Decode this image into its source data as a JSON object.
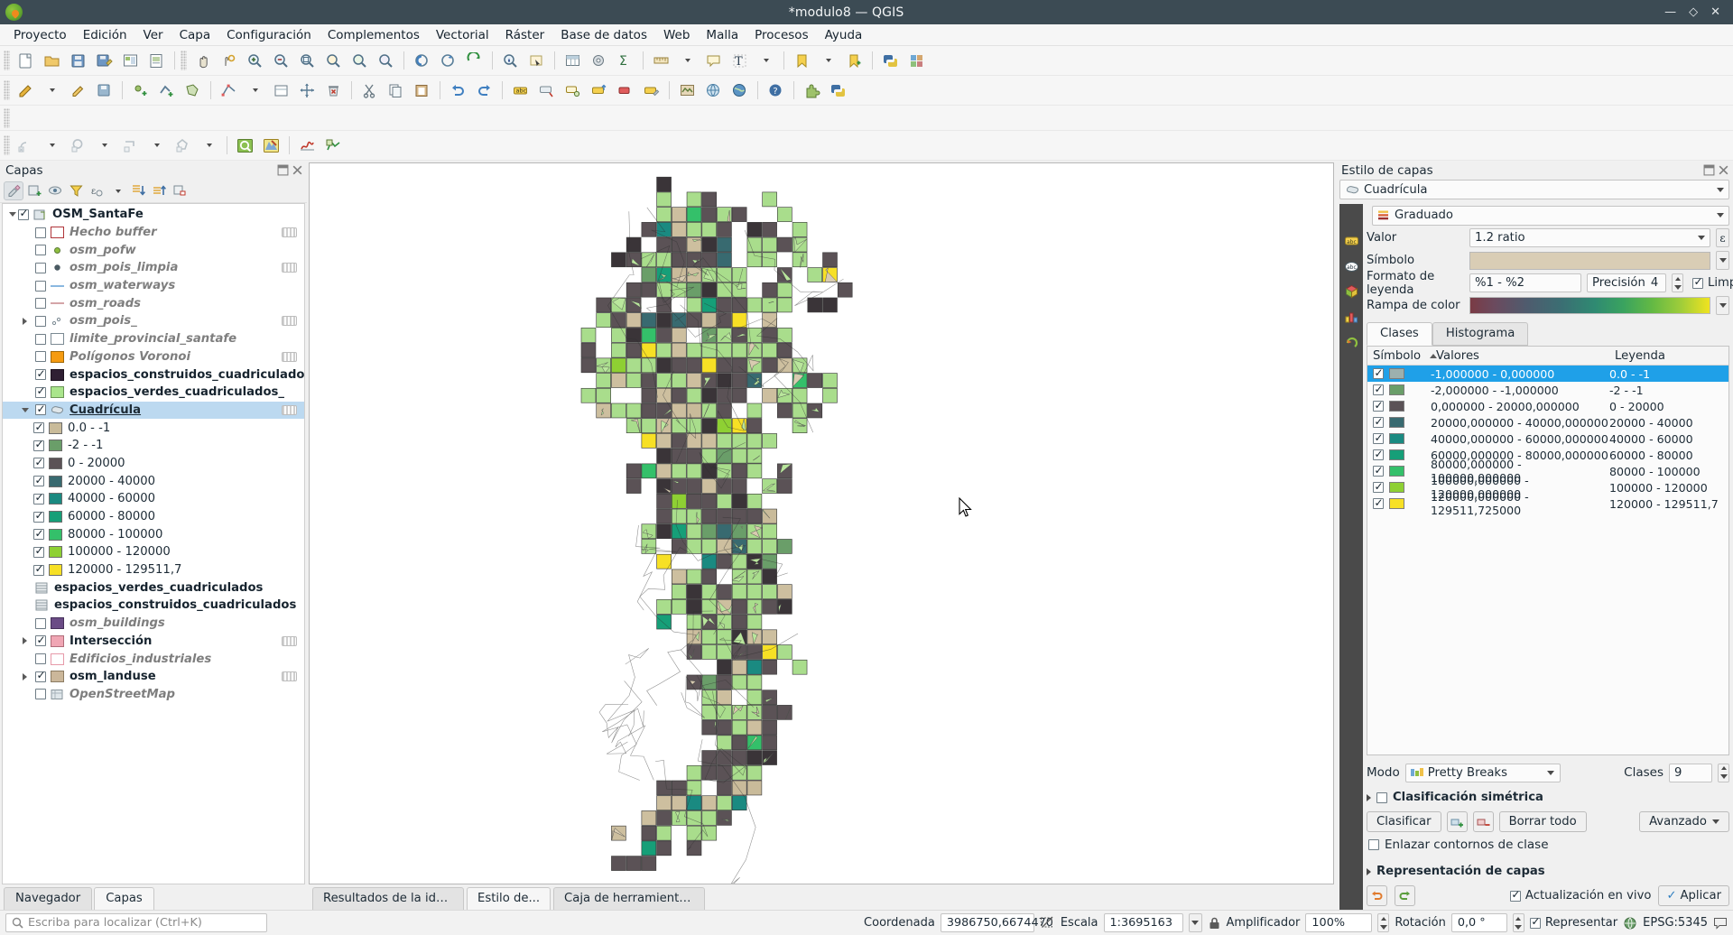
{
  "window": {
    "title": "*modulo8 — QGIS",
    "minimize": "—",
    "maximize": "◇",
    "close": "✕"
  },
  "menubar": {
    "items": [
      "Proyecto",
      "Edición",
      "Ver",
      "Capa",
      "Configuración",
      "Complementos",
      "Vectorial",
      "Ráster",
      "Base de datos",
      "Web",
      "Malla",
      "Procesos",
      "Ayuda"
    ]
  },
  "panels": {
    "layers": {
      "title": "Capas",
      "toolbar_icons": [
        "open-layer-styling-panel-icon",
        "add-group-icon",
        "manage-map-themes-icon",
        "filter-legend-icon",
        "filter-legend-expression-icon",
        "expand-all-icon",
        "collapse-all-icon",
        "remove-layer-icon"
      ],
      "tree": [
        {
          "indent": 0,
          "expander": "down",
          "checked": true,
          "icon": "group-icon",
          "label": "OSM_SantaFe",
          "style": "bold",
          "edit_indicator": false
        },
        {
          "indent": 1,
          "expander": "none",
          "checked": false,
          "icon": "polygon-outline-red-icon",
          "label": "Hecho buffer",
          "style": "italic",
          "edit_indicator": true,
          "swatch": "#ffffff",
          "swatch_border": "#b0353a"
        },
        {
          "indent": 1,
          "expander": "none",
          "checked": false,
          "icon": "point-green-icon",
          "label": "osm_pofw",
          "style": "italic",
          "edit_indicator": false,
          "swatch": "#7fb539"
        },
        {
          "indent": 1,
          "expander": "none",
          "checked": false,
          "icon": "point-dark-icon",
          "label": "osm_pois_limpia",
          "style": "italic",
          "edit_indicator": true,
          "swatch": "#4a5a62"
        },
        {
          "indent": 1,
          "expander": "none",
          "checked": false,
          "icon": "line-blue-icon",
          "label": "osm_waterways",
          "style": "italic",
          "edit_indicator": false,
          "swatch": "#83b4e0"
        },
        {
          "indent": 1,
          "expander": "none",
          "checked": false,
          "icon": "line-pink-icon",
          "label": "osm_roads",
          "style": "italic",
          "edit_indicator": false,
          "swatch": "#d6a7aa"
        },
        {
          "indent": 1,
          "expander": "right",
          "checked": false,
          "icon": "points-multi-icon",
          "label": "osm_pois_",
          "style": "italic",
          "edit_indicator": true,
          "swatch": "#9aa3a8"
        },
        {
          "indent": 1,
          "expander": "none",
          "checked": false,
          "icon": "polygon-white-icon",
          "label": "limite_provincial_santafe",
          "style": "italic",
          "edit_indicator": false,
          "swatch": "#ffffff"
        },
        {
          "indent": 1,
          "expander": "none",
          "checked": false,
          "icon": "polygon-orange-icon",
          "label": "Polígonos Voronoi",
          "style": "italic",
          "edit_indicator": true,
          "swatch": "#f59b11"
        },
        {
          "indent": 1,
          "expander": "none",
          "checked": true,
          "icon": "polygon-darkpurple-icon",
          "label": "espacios_construidos_cuadriculados_",
          "style": "bold",
          "edit_indicator": false,
          "swatch": "#2f1f33"
        },
        {
          "indent": 1,
          "expander": "none",
          "checked": true,
          "icon": "polygon-lightgreen-icon",
          "label": "espacios_verdes_cuadriculados_",
          "style": "bold",
          "edit_indicator": false,
          "swatch": "#aae58c"
        },
        {
          "indent": 1,
          "expander": "down",
          "checked": true,
          "icon": "polygon-layer-icon",
          "label": "Cuadrícula",
          "style": "underline",
          "edit_indicator": true,
          "selected": true
        }
      ],
      "classes": [
        {
          "checked": true,
          "color": "#c9bb9a",
          "label": "0.0 - -1"
        },
        {
          "checked": true,
          "color": "#6a9e69",
          "label": "-2 - -1"
        },
        {
          "checked": true,
          "color": "#5b5256",
          "label": "0 - 20000"
        },
        {
          "checked": true,
          "color": "#386a70",
          "label": "20000 - 40000"
        },
        {
          "checked": true,
          "color": "#1a8a81",
          "label": "40000 - 60000"
        },
        {
          "checked": true,
          "color": "#169f78",
          "label": "60000 - 80000"
        },
        {
          "checked": true,
          "color": "#34c06a",
          "label": "80000 - 100000"
        },
        {
          "checked": true,
          "color": "#8ed033",
          "label": "100000 - 120000"
        },
        {
          "checked": true,
          "color": "#f7e025",
          "label": "120000 - 129511,7"
        }
      ],
      "tree_bottom": [
        {
          "indent": 1,
          "expander": "none",
          "checked": null,
          "icon": "table-icon",
          "label": "espacios_verdes_cuadriculados",
          "style": "bold",
          "edit_indicator": false
        },
        {
          "indent": 1,
          "expander": "none",
          "checked": null,
          "icon": "table-icon",
          "label": "espacios_construidos_cuadriculados",
          "style": "bold",
          "edit_indicator": false
        },
        {
          "indent": 1,
          "expander": "none",
          "checked": false,
          "icon": "polygon-purple-icon",
          "label": "osm_buildings",
          "style": "italic",
          "edit_indicator": false,
          "swatch": "#6b4c86"
        },
        {
          "indent": 1,
          "expander": "right",
          "checked": true,
          "icon": "polygon-pink-icon",
          "label": "Intersección",
          "style": "bold",
          "edit_indicator": true,
          "swatch": "#f0a6b4"
        },
        {
          "indent": 1,
          "expander": "none",
          "checked": false,
          "icon": "polygon-pinkoutline-icon",
          "label": "Edificios_industriales",
          "style": "italic",
          "edit_indicator": false,
          "swatch": "#ffffff"
        },
        {
          "indent": 1,
          "expander": "right",
          "checked": true,
          "icon": "polygon-tan-icon",
          "label": "osm_landuse",
          "style": "bold",
          "edit_indicator": true,
          "swatch": "#cbb79a"
        },
        {
          "indent": 1,
          "expander": "none",
          "checked": false,
          "icon": "basemap-icon",
          "label": "OpenStreetMap",
          "style": "italic",
          "edit_indicator": false
        }
      ],
      "tabs": [
        {
          "label": "Navegador",
          "active": false
        },
        {
          "label": "Capas",
          "active": true
        }
      ]
    },
    "style": {
      "title": "Estilo de capas",
      "layer_name": "Cuadrícula",
      "renderer": "Graduado",
      "fields": {
        "valor_label": "Valor",
        "valor_value": "1.2 ratio",
        "simbolo_label": "Símbolo",
        "formato_label": "Formato de leyenda",
        "formato_value": "%1 - %2",
        "precision_label": "Precisión",
        "precision_value": "4",
        "limpiar_label": "Limpiar",
        "limpiar_checked": true,
        "rampa_label": "Rampa de color"
      },
      "tabs": [
        {
          "label": "Clases",
          "active": true
        },
        {
          "label": "Histograma",
          "active": false
        }
      ],
      "table": {
        "headers": {
          "simbolo": "Símbolo",
          "valores": "Valores",
          "leyenda": "Leyenda"
        },
        "rows": [
          {
            "checked": true,
            "color": "#9cb0ae",
            "valores": "-1,000000 - 0,000000",
            "leyenda": "0.0 - -1",
            "selected": true
          },
          {
            "checked": true,
            "color": "#6a9e69",
            "valores": "-2,000000 - -1,000000",
            "leyenda": "-2 - -1",
            "selected": false
          },
          {
            "checked": true,
            "color": "#5b5256",
            "valores": "0,000000 - 20000,000000",
            "leyenda": "0 - 20000",
            "selected": false
          },
          {
            "checked": true,
            "color": "#386a70",
            "valores": "20000,000000 - 40000,000000",
            "leyenda": "20000 - 40000",
            "selected": false
          },
          {
            "checked": true,
            "color": "#1a8a81",
            "valores": "40000,000000 - 60000,000000",
            "leyenda": "40000 - 60000",
            "selected": false
          },
          {
            "checked": true,
            "color": "#169f78",
            "valores": "60000,000000 - 80000,000000",
            "leyenda": "60000 - 80000",
            "selected": false
          },
          {
            "checked": true,
            "color": "#34c06a",
            "valores": "80000,000000 - 100000,000000",
            "leyenda": "80000 - 100000",
            "selected": false
          },
          {
            "checked": true,
            "color": "#8ed033",
            "valores": "100000,000000 - 120000,000000",
            "leyenda": "100000 - 120000",
            "selected": false
          },
          {
            "checked": true,
            "color": "#f7e025",
            "valores": "120000,000000 - 129511,725000",
            "leyenda": "120000 - 129511,7",
            "selected": false
          }
        ]
      },
      "mode": {
        "label": "Modo",
        "value": "Pretty Breaks"
      },
      "clases": {
        "label": "Clases",
        "value": "9"
      },
      "simetrica": {
        "label": "Clasificación simétrica",
        "checked": false
      },
      "buttons": {
        "clasificar": "Clasificar",
        "add_class": "add-class-icon",
        "delete_class": "delete-class-icon",
        "borrar_todo": "Borrar todo",
        "avanzado": "Avanzado"
      },
      "enlazar": {
        "label": "Enlazar contornos de clase",
        "checked": false
      },
      "representacion": "Representación de capas",
      "actualizacion": {
        "label": "Actualización en vivo",
        "checked": true
      },
      "aplicar": "Aplicar",
      "undo_icon": "undo-icon",
      "redo_icon": "redo-icon",
      "vtabs": [
        "symbology-icon",
        "labels-icon",
        "masks-icon",
        "3dview-icon",
        "diagrams-icon",
        "actions-icon"
      ]
    },
    "bottom_tabs": [
      {
        "label": "Resultados de la identifi...",
        "active": false
      },
      {
        "label": "Estilo de...",
        "active": true
      },
      {
        "label": "Caja de herramientas de Pr...",
        "active": false
      }
    ]
  },
  "statusbar": {
    "locator_placeholder": "Escriba para localizar (Ctrl+K)",
    "coordenada_label": "Coordenada",
    "coordenada_value": "3986750,6674470",
    "escala_label": "Escala",
    "escala_value": "1:3695163",
    "amplificador_label": "Amplificador",
    "amplificador_value": "100%",
    "rotacion_label": "Rotación",
    "rotacion_value": "0,0 °",
    "representar_label": "Representar",
    "representar_checked": true,
    "epsg_label": "EPSG:5345",
    "lock_icon": "lock-icon",
    "messages_icon": "messages-icon"
  },
  "toolbars": {
    "row1": [
      "new-project-icon",
      "open-project-icon",
      "save-project-icon",
      "save-as-icon",
      "layout-manager-icon",
      "new-print-layout-icon",
      "pan-map-icon",
      "pan-to-selection-icon",
      "zoom-in-icon",
      "zoom-out-icon",
      "zoom-full-icon",
      "zoom-selection-icon",
      "zoom-layer-icon",
      "zoom-native-icon",
      "zoom-last-icon",
      "zoom-next-icon",
      "refresh-icon",
      "identify-features-icon",
      "select-features-icon",
      "open-attribute-table-icon",
      "processing-toolbox-icon",
      "statistical-summary-icon",
      "measure-icon",
      "map-tips-icon",
      "text-annotation-icon",
      "bookmarks-icon",
      "new-bookmark-icon",
      "python-console-icon",
      "style-manager-icon"
    ],
    "row2": [
      "current-edits-icon",
      "toggle-editing-icon",
      "save-layer-edits-icon",
      "add-feature-point-icon",
      "add-feature-line-icon",
      "add-feature-polygon-icon",
      "vertex-tool-icon",
      "modify-attributes-icon",
      "move-feature-icon",
      "delete-selected-icon",
      "cut-features-icon",
      "copy-features-icon",
      "paste-features-icon",
      "undo-edit-icon",
      "redo-edit-icon",
      "label-icon",
      "pin-labels-icon",
      "show-hide-labels-icon",
      "move-label-icon",
      "rotate-label-icon",
      "change-label-icon",
      "georeferencer-icon",
      "osm-download-icon",
      "globe-icon",
      "help-icon",
      "plugin-icon",
      "python-plugin-icon"
    ],
    "row3": [
      "digitize-shape-circle-icon",
      "digitize-shape-ellipse-icon",
      "digitize-shape-rectangle-icon",
      "digitize-shape-regular-polygon-icon",
      "trace-icon",
      "reshape-features-icon",
      "split-features-icon",
      "merge-features-icon"
    ],
    "row4": [
      "select-by-location-icon",
      "select-by-expression-icon",
      "deselect-icon",
      "select-polygon-icon",
      "zoom-last-2-icon",
      "measure-line-icon",
      "chart-icon",
      "mesh-icon"
    ]
  }
}
